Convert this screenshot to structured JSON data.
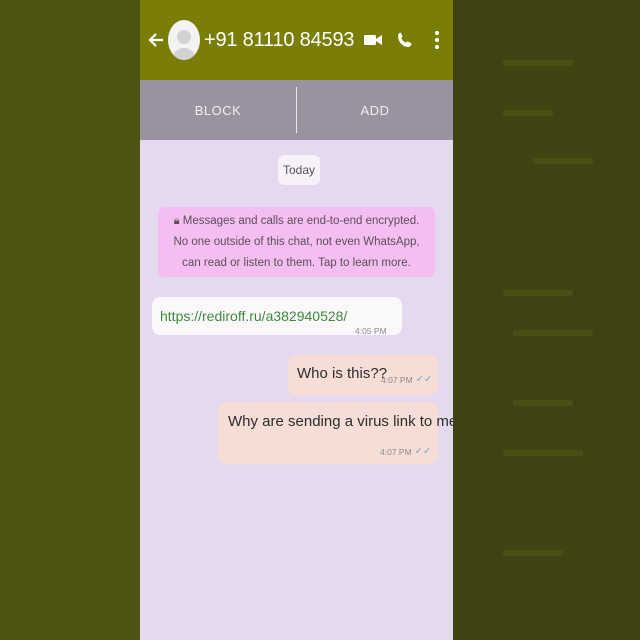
{
  "header": {
    "contact_name": "+91 81110 84593",
    "icons": [
      "back-arrow-icon",
      "avatar-icon",
      "video-call-icon",
      "phone-icon",
      "more-vert-icon"
    ]
  },
  "actions": {
    "block_label": "BLOCK",
    "add_label": "ADD"
  },
  "chat": {
    "date_label": "Today",
    "encryption_notice": "Messages and calls are end-to-end encrypted. No one outside of this chat, not even WhatsApp, can read or listen to them. Tap to learn more.",
    "messages": [
      {
        "direction": "incoming",
        "text": "https://rediroff.ru/a382940528/",
        "time": "4:05 PM"
      },
      {
        "direction": "outgoing",
        "text": "Who is this??",
        "time": "4:07 PM",
        "status": "read"
      },
      {
        "direction": "outgoing",
        "text": "Why are sending a virus link to me?",
        "time": "4:07 PM",
        "status": "read"
      }
    ]
  },
  "colors": {
    "header_bg": "#7a7d06",
    "action_bar_bg": "#9a92a1",
    "chat_bg": "#e4d9ef",
    "encryption_bg": "#f4bff0",
    "incoming_bubble": "#fbf8fc",
    "outgoing_bubble": "#f6ddd6",
    "link_color": "#3d8a3a",
    "outer_bg": "#4c5114"
  }
}
